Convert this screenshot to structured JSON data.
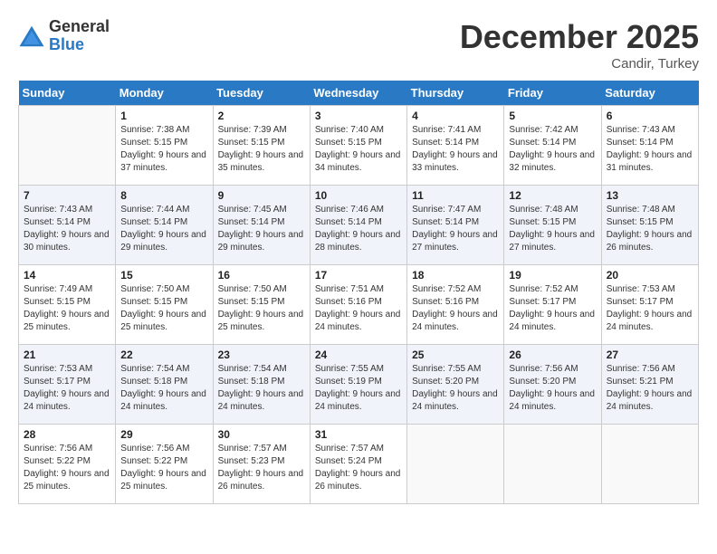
{
  "header": {
    "logo_general": "General",
    "logo_blue": "Blue",
    "month_title": "December 2025",
    "location": "Candir, Turkey"
  },
  "weekdays": [
    "Sunday",
    "Monday",
    "Tuesday",
    "Wednesday",
    "Thursday",
    "Friday",
    "Saturday"
  ],
  "weeks": [
    [
      {
        "day": "",
        "sunrise": "",
        "sunset": "",
        "daylight": ""
      },
      {
        "day": "1",
        "sunrise": "Sunrise: 7:38 AM",
        "sunset": "Sunset: 5:15 PM",
        "daylight": "Daylight: 9 hours and 37 minutes."
      },
      {
        "day": "2",
        "sunrise": "Sunrise: 7:39 AM",
        "sunset": "Sunset: 5:15 PM",
        "daylight": "Daylight: 9 hours and 35 minutes."
      },
      {
        "day": "3",
        "sunrise": "Sunrise: 7:40 AM",
        "sunset": "Sunset: 5:15 PM",
        "daylight": "Daylight: 9 hours and 34 minutes."
      },
      {
        "day": "4",
        "sunrise": "Sunrise: 7:41 AM",
        "sunset": "Sunset: 5:14 PM",
        "daylight": "Daylight: 9 hours and 33 minutes."
      },
      {
        "day": "5",
        "sunrise": "Sunrise: 7:42 AM",
        "sunset": "Sunset: 5:14 PM",
        "daylight": "Daylight: 9 hours and 32 minutes."
      },
      {
        "day": "6",
        "sunrise": "Sunrise: 7:43 AM",
        "sunset": "Sunset: 5:14 PM",
        "daylight": "Daylight: 9 hours and 31 minutes."
      }
    ],
    [
      {
        "day": "7",
        "sunrise": "Sunrise: 7:43 AM",
        "sunset": "Sunset: 5:14 PM",
        "daylight": "Daylight: 9 hours and 30 minutes."
      },
      {
        "day": "8",
        "sunrise": "Sunrise: 7:44 AM",
        "sunset": "Sunset: 5:14 PM",
        "daylight": "Daylight: 9 hours and 29 minutes."
      },
      {
        "day": "9",
        "sunrise": "Sunrise: 7:45 AM",
        "sunset": "Sunset: 5:14 PM",
        "daylight": "Daylight: 9 hours and 29 minutes."
      },
      {
        "day": "10",
        "sunrise": "Sunrise: 7:46 AM",
        "sunset": "Sunset: 5:14 PM",
        "daylight": "Daylight: 9 hours and 28 minutes."
      },
      {
        "day": "11",
        "sunrise": "Sunrise: 7:47 AM",
        "sunset": "Sunset: 5:14 PM",
        "daylight": "Daylight: 9 hours and 27 minutes."
      },
      {
        "day": "12",
        "sunrise": "Sunrise: 7:48 AM",
        "sunset": "Sunset: 5:15 PM",
        "daylight": "Daylight: 9 hours and 27 minutes."
      },
      {
        "day": "13",
        "sunrise": "Sunrise: 7:48 AM",
        "sunset": "Sunset: 5:15 PM",
        "daylight": "Daylight: 9 hours and 26 minutes."
      }
    ],
    [
      {
        "day": "14",
        "sunrise": "Sunrise: 7:49 AM",
        "sunset": "Sunset: 5:15 PM",
        "daylight": "Daylight: 9 hours and 25 minutes."
      },
      {
        "day": "15",
        "sunrise": "Sunrise: 7:50 AM",
        "sunset": "Sunset: 5:15 PM",
        "daylight": "Daylight: 9 hours and 25 minutes."
      },
      {
        "day": "16",
        "sunrise": "Sunrise: 7:50 AM",
        "sunset": "Sunset: 5:15 PM",
        "daylight": "Daylight: 9 hours and 25 minutes."
      },
      {
        "day": "17",
        "sunrise": "Sunrise: 7:51 AM",
        "sunset": "Sunset: 5:16 PM",
        "daylight": "Daylight: 9 hours and 24 minutes."
      },
      {
        "day": "18",
        "sunrise": "Sunrise: 7:52 AM",
        "sunset": "Sunset: 5:16 PM",
        "daylight": "Daylight: 9 hours and 24 minutes."
      },
      {
        "day": "19",
        "sunrise": "Sunrise: 7:52 AM",
        "sunset": "Sunset: 5:17 PM",
        "daylight": "Daylight: 9 hours and 24 minutes."
      },
      {
        "day": "20",
        "sunrise": "Sunrise: 7:53 AM",
        "sunset": "Sunset: 5:17 PM",
        "daylight": "Daylight: 9 hours and 24 minutes."
      }
    ],
    [
      {
        "day": "21",
        "sunrise": "Sunrise: 7:53 AM",
        "sunset": "Sunset: 5:17 PM",
        "daylight": "Daylight: 9 hours and 24 minutes."
      },
      {
        "day": "22",
        "sunrise": "Sunrise: 7:54 AM",
        "sunset": "Sunset: 5:18 PM",
        "daylight": "Daylight: 9 hours and 24 minutes."
      },
      {
        "day": "23",
        "sunrise": "Sunrise: 7:54 AM",
        "sunset": "Sunset: 5:18 PM",
        "daylight": "Daylight: 9 hours and 24 minutes."
      },
      {
        "day": "24",
        "sunrise": "Sunrise: 7:55 AM",
        "sunset": "Sunset: 5:19 PM",
        "daylight": "Daylight: 9 hours and 24 minutes."
      },
      {
        "day": "25",
        "sunrise": "Sunrise: 7:55 AM",
        "sunset": "Sunset: 5:20 PM",
        "daylight": "Daylight: 9 hours and 24 minutes."
      },
      {
        "day": "26",
        "sunrise": "Sunrise: 7:56 AM",
        "sunset": "Sunset: 5:20 PM",
        "daylight": "Daylight: 9 hours and 24 minutes."
      },
      {
        "day": "27",
        "sunrise": "Sunrise: 7:56 AM",
        "sunset": "Sunset: 5:21 PM",
        "daylight": "Daylight: 9 hours and 24 minutes."
      }
    ],
    [
      {
        "day": "28",
        "sunrise": "Sunrise: 7:56 AM",
        "sunset": "Sunset: 5:22 PM",
        "daylight": "Daylight: 9 hours and 25 minutes."
      },
      {
        "day": "29",
        "sunrise": "Sunrise: 7:56 AM",
        "sunset": "Sunset: 5:22 PM",
        "daylight": "Daylight: 9 hours and 25 minutes."
      },
      {
        "day": "30",
        "sunrise": "Sunrise: 7:57 AM",
        "sunset": "Sunset: 5:23 PM",
        "daylight": "Daylight: 9 hours and 26 minutes."
      },
      {
        "day": "31",
        "sunrise": "Sunrise: 7:57 AM",
        "sunset": "Sunset: 5:24 PM",
        "daylight": "Daylight: 9 hours and 26 minutes."
      },
      {
        "day": "",
        "sunrise": "",
        "sunset": "",
        "daylight": ""
      },
      {
        "day": "",
        "sunrise": "",
        "sunset": "",
        "daylight": ""
      },
      {
        "day": "",
        "sunrise": "",
        "sunset": "",
        "daylight": ""
      }
    ]
  ]
}
